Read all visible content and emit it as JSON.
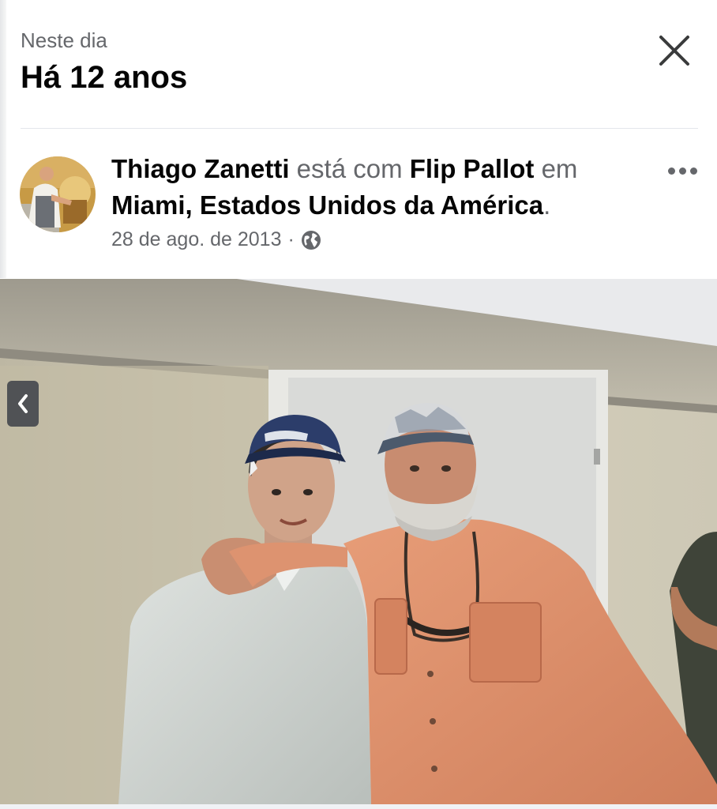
{
  "header": {
    "subtitle": "Neste dia",
    "title": "Há 12 anos",
    "close_icon": "close-icon"
  },
  "post": {
    "author": "Thiago Zanetti",
    "with_text": "está com",
    "tagged": "Flip Pallot",
    "in_text": "em",
    "location": "Miami, Estados Unidos da América",
    "end_punct": ".",
    "date": "28 de ago. de 2013",
    "separator": "·",
    "privacy_icon": "globe-icon",
    "more_icon": "more-options-icon"
  },
  "photo": {
    "nav_prev_icon": "chevron-left-icon"
  },
  "colors": {
    "primary_text": "#050505",
    "secondary_text": "#65676b",
    "divider": "#e4e6eb"
  }
}
